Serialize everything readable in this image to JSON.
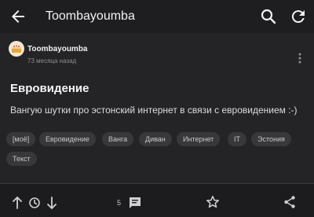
{
  "header": {
    "title": "Toombayoumba"
  },
  "post": {
    "author": "Toombayoumba",
    "time": "73 месяца назад",
    "title": "Евровидение",
    "body": "Вангую шутки про эстонский интернет в связи с евровидением :-)",
    "tags": [
      "[моё]",
      "Евровидение",
      "Ванга",
      "Диван",
      "Интернет",
      "IT",
      "Эстония",
      "Текст"
    ]
  },
  "actions": {
    "comments_count": "5"
  },
  "icons": {
    "back": "arrow-left-icon",
    "search": "search-icon",
    "refresh": "refresh-icon",
    "more": "more-vertical-icon",
    "upvote": "arrow-up-icon",
    "save_later": "clock-icon",
    "downvote": "arrow-down-icon",
    "comments": "comment-icon",
    "favorite": "star-icon",
    "share": "share-icon"
  }
}
